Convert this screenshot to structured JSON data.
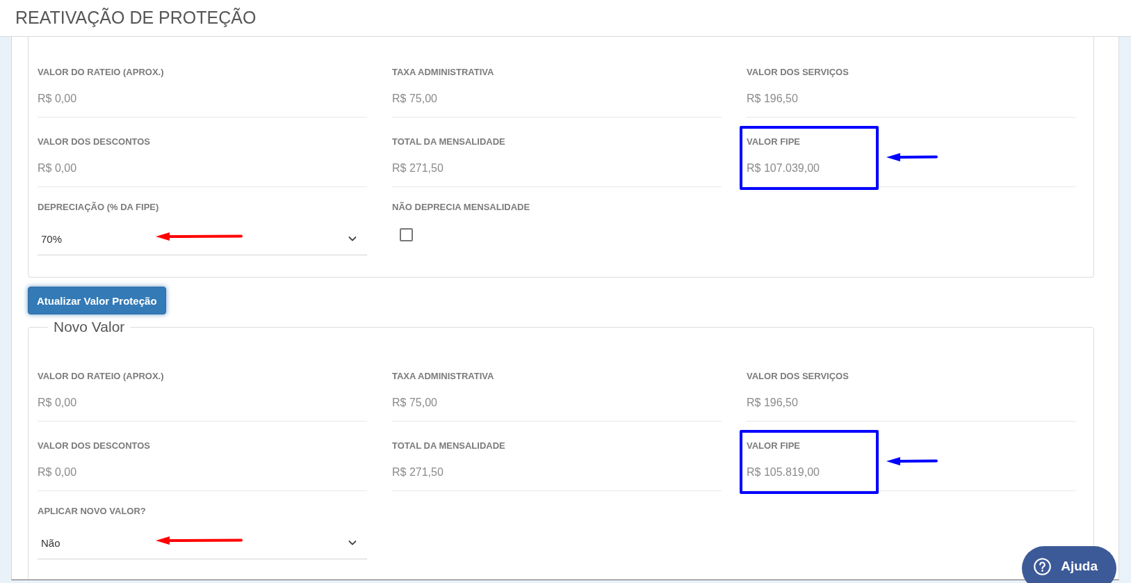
{
  "page": {
    "title": "REATIVAÇÃO DE PROTEÇÃO"
  },
  "current_values": {
    "fields": [
      {
        "kind": "readout",
        "label": "VALOR DO RATEIO (APROX.)",
        "value": "R$ 0,00"
      },
      {
        "kind": "readout",
        "label": "TAXA ADMINISTRATIVA",
        "value": "R$ 75,00"
      },
      {
        "kind": "readout",
        "label": "VALOR DOS SERVIÇOS",
        "value": "R$ 196,50"
      },
      {
        "kind": "readout",
        "label": "VALOR DOS DESCONTOS",
        "value": "R$ 0,00"
      },
      {
        "kind": "readout",
        "label": "TOTAL DA MENSALIDADE",
        "value": "R$ 271,50"
      },
      {
        "kind": "readout",
        "label": "VALOR FIPE",
        "value": "R$ 107.039,00",
        "annotation": {
          "kind": "frame-and-arrow",
          "color": "#0000ff"
        }
      },
      {
        "kind": "select",
        "label": "DEPRECIAÇÃO (% DA FIPE)",
        "value": "70%",
        "annotation": {
          "kind": "arrow",
          "color": "#ff0000"
        }
      },
      {
        "kind": "checkbox",
        "label": "NÃO DEPRECIA MENSALIDADE",
        "checked": false
      }
    ]
  },
  "update_button": {
    "label": "Atualizar Valor Proteção"
  },
  "new_value": {
    "legend": "Novo Valor",
    "fields": [
      {
        "kind": "readout",
        "label": "VALOR DO RATEIO (APROX.)",
        "value": "R$ 0,00"
      },
      {
        "kind": "readout",
        "label": "TAXA ADMINISTRATIVA",
        "value": "R$ 75,00"
      },
      {
        "kind": "readout",
        "label": "VALOR DOS SERVIÇOS",
        "value": "R$ 196,50"
      },
      {
        "kind": "readout",
        "label": "VALOR DOS DESCONTOS",
        "value": "R$ 0,00"
      },
      {
        "kind": "readout",
        "label": "TOTAL DA MENSALIDADE",
        "value": "R$ 271,50"
      },
      {
        "kind": "readout",
        "label": "VALOR FIPE",
        "value": "R$ 105.819,00",
        "annotation": {
          "kind": "frame-and-arrow",
          "color": "#0000ff"
        }
      },
      {
        "kind": "select",
        "label": "APLICAR NOVO VALOR?",
        "value": "Não",
        "annotation": {
          "kind": "arrow",
          "color": "#ff0000"
        }
      }
    ]
  },
  "help_button": {
    "label": "Ajuda"
  }
}
